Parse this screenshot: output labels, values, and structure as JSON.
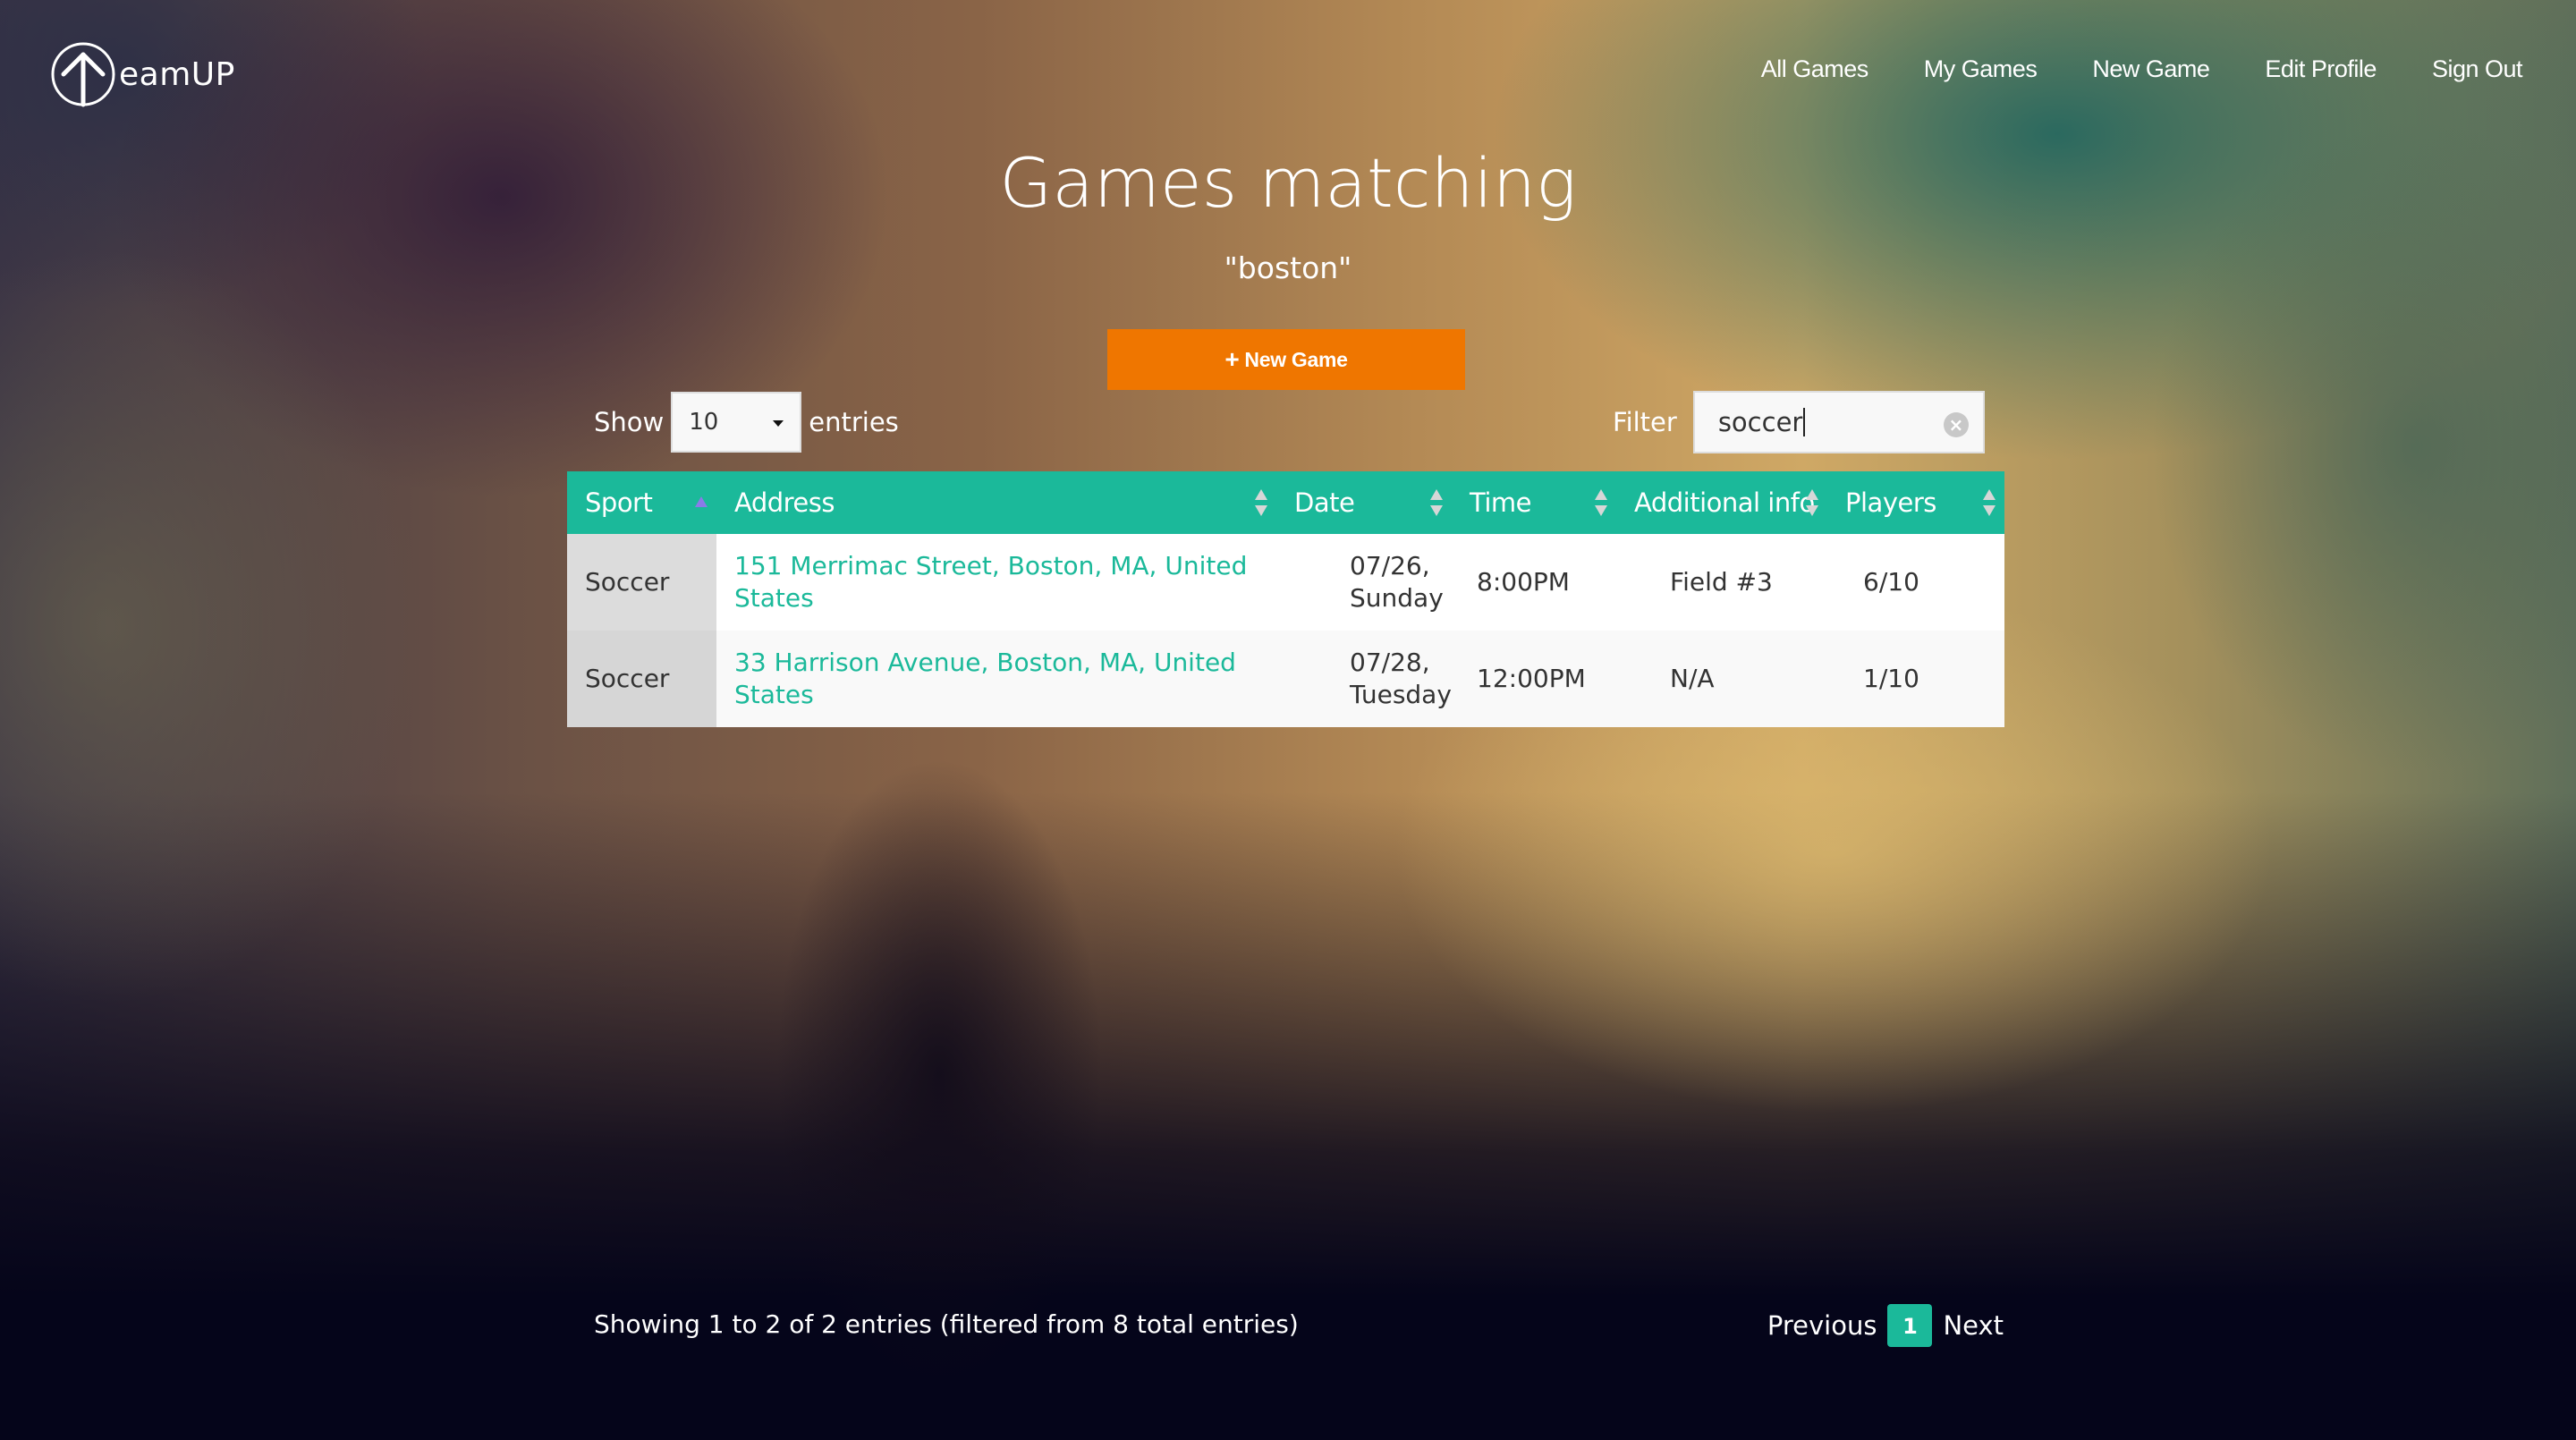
{
  "app": {
    "logo_text": "eamUP",
    "logo_icon": "arrow-up-circle-icon"
  },
  "nav": {
    "items": [
      {
        "label": "All Games"
      },
      {
        "label": "My Games"
      },
      {
        "label": "New Game"
      },
      {
        "label": "Edit Profile"
      },
      {
        "label": "Sign Out"
      }
    ]
  },
  "page": {
    "title": "Games matching",
    "query": "\"boston\"",
    "new_game_button": {
      "icon": "plus-icon",
      "plus": "+",
      "label": "New Game"
    }
  },
  "length_control": {
    "prefix": "Show",
    "selected": "10",
    "suffix": "entries"
  },
  "filter": {
    "label": "Filter",
    "value": "soccer",
    "clear_icon": "×"
  },
  "table": {
    "columns": [
      {
        "label": "Sport",
        "sort": "asc"
      },
      {
        "label": "Address",
        "sort": "both"
      },
      {
        "label": "Date",
        "sort": "both"
      },
      {
        "label": "Time",
        "sort": "both"
      },
      {
        "label": "Additional info",
        "sort": "both"
      },
      {
        "label": "Players",
        "sort": "both"
      }
    ],
    "rows": [
      {
        "sport": "Soccer",
        "address": "151 Merrimac Street, Boston, MA, United States",
        "date": "07/26,",
        "day": "Sunday",
        "time": "8:00PM",
        "info": "Field #3",
        "players": "6/10"
      },
      {
        "sport": "Soccer",
        "address": "33 Harrison Avenue, Boston, MA, United States",
        "date": "07/28,",
        "day": "Tuesday",
        "time": "12:00PM",
        "info": "N/A",
        "players": "1/10"
      }
    ]
  },
  "footer": {
    "info": "Showing 1 to 2 of 2 entries (filtered from 8 total entries)",
    "previous": "Previous",
    "current_page": "1",
    "next": "Next"
  },
  "colors": {
    "accent": "#1bb99a",
    "button": "#ef7600",
    "sort_active": "#8a7be8"
  }
}
